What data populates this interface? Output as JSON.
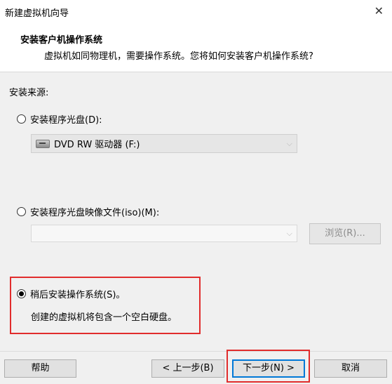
{
  "window": {
    "title": "新建虚拟机向导",
    "close_glyph": "✕"
  },
  "header": {
    "title": "安装客户机操作系统",
    "subtitle": "虚拟机如同物理机，需要操作系统。您将如何安装客户机操作系统?"
  },
  "source_label": "安装来源:",
  "options": {
    "disc": {
      "label": "安装程序光盘(D):",
      "selected": false,
      "drive_value": "DVD RW 驱动器 (F:)"
    },
    "iso": {
      "label": "安装程序光盘映像文件(iso)(M):",
      "selected": false,
      "path_value": "",
      "browse_label": "浏览(R)..."
    },
    "later": {
      "label": "稍后安装操作系统(S)。",
      "selected": true,
      "description": "创建的虚拟机将包含一个空白硬盘。"
    }
  },
  "buttons": {
    "help": "帮助",
    "back": "< 上一步(B)",
    "next": "下一步(N) >",
    "cancel": "取消"
  }
}
